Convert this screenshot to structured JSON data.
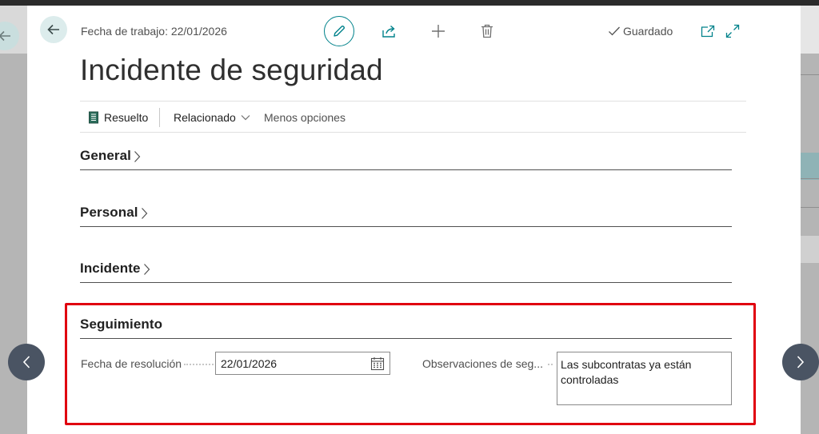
{
  "header": {
    "work_date": "Fecha de trabajo: 22/01/2026",
    "saved_label": "Guardado"
  },
  "page": {
    "title": "Incidente de seguridad"
  },
  "actions": {
    "resuelto": "Resuelto",
    "relacionado": "Relacionado",
    "menos_opciones": "Menos opciones"
  },
  "sections": {
    "general": "General",
    "personal": "Personal",
    "incidente": "Incidente",
    "seguimiento": "Seguimiento"
  },
  "fields": {
    "fecha_label": "Fecha de resolución",
    "fecha_value": "22/01/2026",
    "obs_label": "Observaciones de seg...",
    "obs_value": "Las subcontratas ya están controladas"
  },
  "colors": {
    "accent": "#00828b",
    "highlight": "#e0000f",
    "nav": "#4a5463"
  }
}
